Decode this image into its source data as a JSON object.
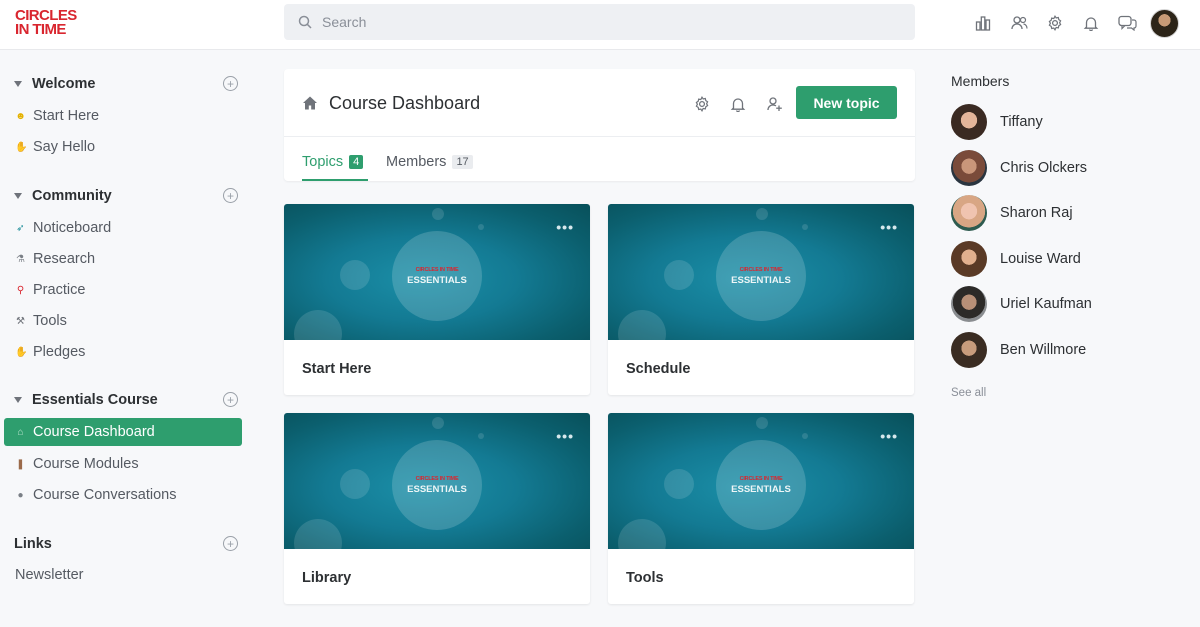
{
  "logo": {
    "line1": "CIRCLES",
    "line2": "IN TIME"
  },
  "search": {
    "placeholder": "Search"
  },
  "top_icons": [
    "chart-icon",
    "people-icon",
    "gear-icon",
    "bell-icon",
    "chat-icon"
  ],
  "sidebar": {
    "welcome": {
      "title": "Welcome",
      "items": [
        {
          "label": "Start Here",
          "icon": "smiley-icon"
        },
        {
          "label": "Say Hello",
          "icon": "wave-icon"
        }
      ]
    },
    "community": {
      "title": "Community",
      "items": [
        {
          "label": "Noticeboard",
          "icon": "rocket-icon"
        },
        {
          "label": "Research",
          "icon": "flask-icon"
        },
        {
          "label": "Practice",
          "icon": "bike-icon"
        },
        {
          "label": "Tools",
          "icon": "tools-icon"
        },
        {
          "label": "Pledges",
          "icon": "hand-icon"
        }
      ]
    },
    "essentials": {
      "title": "Essentials Course",
      "items": [
        {
          "label": "Course Dashboard",
          "icon": "home-icon",
          "active": true
        },
        {
          "label": "Course Modules",
          "icon": "book-icon"
        },
        {
          "label": "Course Conversations",
          "icon": "speech-icon"
        }
      ]
    },
    "links": {
      "title": "Links",
      "items": [
        {
          "label": "Newsletter"
        }
      ]
    }
  },
  "course": {
    "title": "Course Dashboard",
    "new_topic": "New topic",
    "tabs": [
      {
        "label": "Topics",
        "count": "4"
      },
      {
        "label": "Members",
        "count": "17"
      }
    ]
  },
  "cards": [
    {
      "title": "Start Here",
      "brand_small": "CIRCLES IN TIME",
      "brand_big": "ESSENTIALS",
      "more": "•••"
    },
    {
      "title": "Schedule",
      "brand_small": "CIRCLES IN TIME",
      "brand_big": "ESSENTIALS",
      "more": "•••"
    },
    {
      "title": "Library",
      "brand_small": "CIRCLES IN TIME",
      "brand_big": "ESSENTIALS",
      "more": "•••"
    },
    {
      "title": "Tools",
      "brand_small": "CIRCLES IN TIME",
      "brand_big": "ESSENTIALS",
      "more": "•••"
    }
  ],
  "members_panel": {
    "title": "Members",
    "members": [
      {
        "name": "Tiffany"
      },
      {
        "name": "Chris Olckers"
      },
      {
        "name": "Sharon Raj"
      },
      {
        "name": "Louise Ward"
      },
      {
        "name": "Uriel Kaufman"
      },
      {
        "name": "Ben Willmore"
      }
    ],
    "see_all": "See all"
  },
  "colors": {
    "accent": "#2e9e6e",
    "brand_red": "#d9262f",
    "teal_thumb": "#137a93"
  }
}
